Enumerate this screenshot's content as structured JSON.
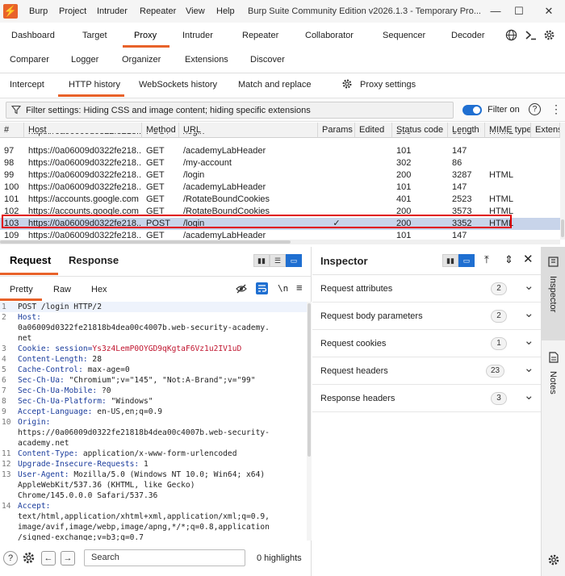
{
  "titlebar": {
    "logo": "⚡",
    "menus": [
      "Burp",
      "Project",
      "Intruder",
      "Repeater",
      "View",
      "Help"
    ],
    "title": "Burp Suite Community Edition v2026.1.3 - Temporary Pro...",
    "minimize": "—",
    "maximize": "☐",
    "close": "✕"
  },
  "main_tabs": {
    "row1": [
      "Dashboard",
      "Target",
      "Proxy",
      "Intruder",
      "Repeater",
      "Collaborator",
      "Sequencer",
      "Decoder"
    ],
    "row2": [
      "Comparer",
      "Logger",
      "Organizer",
      "Extensions",
      "Discover"
    ],
    "active": "Proxy"
  },
  "proxy_tabs": {
    "items": [
      "Intercept",
      "HTTP history",
      "WebSockets history",
      "Match and replace"
    ],
    "settings": "Proxy settings",
    "active": "HTTP history"
  },
  "filter": {
    "text": "Filter settings: Hiding CSS and image content; hiding specific extensions",
    "toggle_label": "Filter on",
    "help": "?",
    "more": "⋮"
  },
  "history": {
    "columns": [
      "#",
      "Host",
      "Method",
      "URL",
      "Params",
      "Edited",
      "Status code",
      "Length",
      "MIME type",
      "Extens"
    ],
    "rows": [
      {
        "num": "",
        "host": "https://0a06009d0322fe218...",
        "method": "POST",
        "url": "/login",
        "params": "✓",
        "edited": "",
        "status": "200",
        "length": "3352",
        "mime": "HTML"
      },
      {
        "num": "97",
        "host": "https://0a06009d0322fe218...",
        "method": "GET",
        "url": "/academyLabHeader",
        "params": "",
        "edited": "",
        "status": "101",
        "length": "147",
        "mime": ""
      },
      {
        "num": "98",
        "host": "https://0a06009d0322fe218...",
        "method": "GET",
        "url": "/my-account",
        "params": "",
        "edited": "",
        "status": "302",
        "length": "86",
        "mime": ""
      },
      {
        "num": "99",
        "host": "https://0a06009d0322fe218...",
        "method": "GET",
        "url": "/login",
        "params": "",
        "edited": "",
        "status": "200",
        "length": "3287",
        "mime": "HTML"
      },
      {
        "num": "100",
        "host": "https://0a06009d0322fe218...",
        "method": "GET",
        "url": "/academyLabHeader",
        "params": "",
        "edited": "",
        "status": "101",
        "length": "147",
        "mime": ""
      },
      {
        "num": "101",
        "host": "https://accounts.google.com",
        "method": "GET",
        "url": "/RotateBoundCookies",
        "params": "",
        "edited": "",
        "status": "401",
        "length": "2523",
        "mime": "HTML"
      },
      {
        "num": "102",
        "host": "https://accounts.google.com",
        "method": "GET",
        "url": "/RotateBoundCookies",
        "params": "",
        "edited": "",
        "status": "200",
        "length": "3573",
        "mime": "HTML"
      },
      {
        "num": "103",
        "host": "https://0a06009d0322fe218...",
        "method": "POST",
        "url": "/login",
        "params": "✓",
        "edited": "",
        "status": "200",
        "length": "3352",
        "mime": "HTML"
      },
      {
        "num": "109",
        "host": "https://0a06009d0322fe218...",
        "method": "GET",
        "url": "/academyLabHeader",
        "params": "",
        "edited": "",
        "status": "101",
        "length": "147",
        "mime": ""
      }
    ],
    "selected_num": "103"
  },
  "request_pane": {
    "tabs": [
      "Request",
      "Response"
    ],
    "active_tab": "Request",
    "subtabs": [
      "Pretty",
      "Raw",
      "Hex"
    ],
    "active_subtab": "Pretty",
    "newline_toggle": "\\n",
    "lines": [
      {
        "n": "1",
        "segs": [
          {
            "t": "POST /login HTTP/2",
            "c": ""
          }
        ]
      },
      {
        "n": "2",
        "segs": [
          {
            "t": "Host:",
            "c": "key"
          }
        ]
      },
      {
        "n": "",
        "segs": [
          {
            "t": "0a06009d0322fe21818b4dea00c4007b.web-security-academy.",
            "c": ""
          }
        ]
      },
      {
        "n": "",
        "segs": [
          {
            "t": "net",
            "c": ""
          }
        ]
      },
      {
        "n": "3",
        "segs": [
          {
            "t": "Cookie:",
            "c": "key"
          },
          {
            "t": " session=",
            "c": "key"
          },
          {
            "t": "Ys3z4LemP0OYGD9qKgtaF6Vz1u2IV1uD",
            "c": "cookie"
          }
        ]
      },
      {
        "n": "4",
        "segs": [
          {
            "t": "Content-Length:",
            "c": "key"
          },
          {
            "t": " 28",
            "c": ""
          }
        ]
      },
      {
        "n": "5",
        "segs": [
          {
            "t": "Cache-Control:",
            "c": "key"
          },
          {
            "t": " max-age=0",
            "c": ""
          }
        ]
      },
      {
        "n": "6",
        "segs": [
          {
            "t": "Sec-Ch-Ua:",
            "c": "key"
          },
          {
            "t": " \"Chromium\";v=\"145\", \"Not:A-Brand\";v=\"99\"",
            "c": ""
          }
        ]
      },
      {
        "n": "7",
        "segs": [
          {
            "t": "Sec-Ch-Ua-Mobile:",
            "c": "key"
          },
          {
            "t": " ?0",
            "c": ""
          }
        ]
      },
      {
        "n": "8",
        "segs": [
          {
            "t": "Sec-Ch-Ua-Platform:",
            "c": "key"
          },
          {
            "t": " \"Windows\"",
            "c": ""
          }
        ]
      },
      {
        "n": "9",
        "segs": [
          {
            "t": "Accept-Language:",
            "c": "key"
          },
          {
            "t": " en-US,en;q=0.9",
            "c": ""
          }
        ]
      },
      {
        "n": "10",
        "segs": [
          {
            "t": "Origin:",
            "c": "key"
          }
        ]
      },
      {
        "n": "",
        "segs": [
          {
            "t": "https://0a06009d0322fe21818b4dea00c4007b.web-security-",
            "c": ""
          }
        ]
      },
      {
        "n": "",
        "segs": [
          {
            "t": "academy.net",
            "c": ""
          }
        ]
      },
      {
        "n": "11",
        "segs": [
          {
            "t": "Content-Type:",
            "c": "key"
          },
          {
            "t": " application/x-www-form-urlencoded",
            "c": ""
          }
        ]
      },
      {
        "n": "12",
        "segs": [
          {
            "t": "Upgrade-Insecure-Requests:",
            "c": "key"
          },
          {
            "t": " 1",
            "c": ""
          }
        ]
      },
      {
        "n": "13",
        "segs": [
          {
            "t": "User-Agent:",
            "c": "key"
          },
          {
            "t": " Mozilla/5.0 (Windows NT 10.0; Win64; x64)",
            "c": ""
          }
        ]
      },
      {
        "n": "",
        "segs": [
          {
            "t": "AppleWebKit/537.36 (KHTML, like Gecko)",
            "c": ""
          }
        ]
      },
      {
        "n": "",
        "segs": [
          {
            "t": "Chrome/145.0.0.0 Safari/537.36",
            "c": ""
          }
        ]
      },
      {
        "n": "14",
        "segs": [
          {
            "t": "Accept:",
            "c": "key"
          }
        ]
      },
      {
        "n": "",
        "segs": [
          {
            "t": "text/html,application/xhtml+xml,application/xml;q=0.9,",
            "c": ""
          }
        ]
      },
      {
        "n": "",
        "segs": [
          {
            "t": "image/avif,image/webp,image/apng,*/*;q=0.8,application",
            "c": ""
          }
        ]
      },
      {
        "n": "",
        "segs": [
          {
            "t": "/signed-exchange;v=b3;q=0.7",
            "c": ""
          }
        ]
      }
    ],
    "search_placeholder": "Search",
    "highlights": "0 highlights"
  },
  "inspector": {
    "title": "Inspector",
    "sections": [
      {
        "label": "Request attributes",
        "count": "2"
      },
      {
        "label": "Request body parameters",
        "count": "2"
      },
      {
        "label": "Request cookies",
        "count": "1"
      },
      {
        "label": "Request headers",
        "count": "23"
      },
      {
        "label": "Response headers",
        "count": "3"
      }
    ]
  },
  "side_tabs": [
    "Inspector",
    "Notes"
  ],
  "colors": {
    "accent": "#e8622a",
    "selection": "#c8d4ea",
    "highlight_box": "#e00000",
    "toggle": "#1f6fd1"
  }
}
